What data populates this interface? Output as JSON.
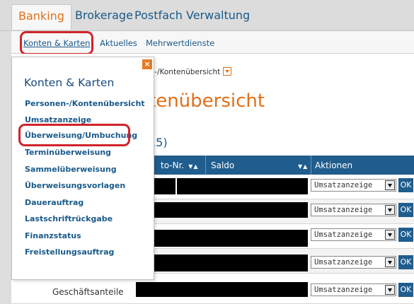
{
  "tabs": [
    "Banking",
    "Brokerage",
    "Postfach",
    "Verwaltung"
  ],
  "subnav": [
    "Konten & Karten",
    "Aktuelles",
    "Mehrwertdienste"
  ],
  "breadcrumb": "onen-/Kontenübersicht",
  "page_title": "tenübersicht",
  "count_text": "15)",
  "table": {
    "headers": [
      "to-Nr.",
      "Saldo",
      "Aktionen"
    ],
    "sort_glyph": "▼▲",
    "rows": [
      {
        "name": "",
        "action": "Umsatzanzeige",
        "ok": "OK"
      },
      {
        "name": "",
        "action": "Umsatzanzeige",
        "ok": "OK"
      },
      {
        "name": "",
        "action": "Umsatzanzeige",
        "ok": "OK"
      },
      {
        "name": "",
        "action": "Umsatzanzeige",
        "ok": "OK"
      },
      {
        "name": "Geschäftsanteile",
        "action": "Umsatzanzeige",
        "ok": "OK"
      }
    ]
  },
  "menu": {
    "close_glyph": "×",
    "title": "Konten & Karten",
    "items": [
      "Personen-/Kontenübersicht",
      "Umsatzanzeige",
      "Überweisung/Umbuchung",
      "Terminüberweisung",
      "Sammelüberweisung",
      "Überweisungsvorlagen",
      "Dauerauftrag",
      "Lastschriftrückgabe",
      "Finanzstatus",
      "Freistellungsauftrag"
    ]
  },
  "colors": {
    "accent_orange": "#e0701a",
    "link_blue": "#1a5a8a",
    "header_blue": "#1f5d8e",
    "highlight_red": "#d1232a"
  }
}
